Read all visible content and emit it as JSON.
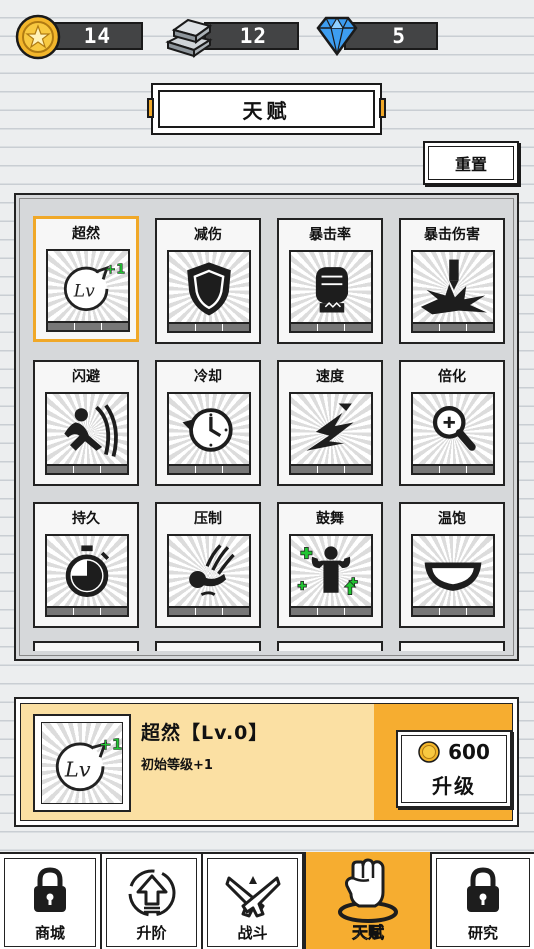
{
  "resources": {
    "coins": "14",
    "silver": "12",
    "diamonds": "5"
  },
  "title": "天赋",
  "reset_label": "重置",
  "talents": [
    {
      "name": "超然",
      "icon": "level-up-icon",
      "selected": true
    },
    {
      "name": "减伤",
      "icon": "shield-icon"
    },
    {
      "name": "暴击率",
      "icon": "fist-icon"
    },
    {
      "name": "暴击伤害",
      "icon": "critical-burst-icon"
    },
    {
      "name": "闪避",
      "icon": "dodge-icon"
    },
    {
      "name": "冷却",
      "icon": "cooldown-clock-icon"
    },
    {
      "name": "速度",
      "icon": "speed-icon"
    },
    {
      "name": "倍化",
      "icon": "magnify-icon"
    },
    {
      "name": "持久",
      "icon": "stopwatch-icon"
    },
    {
      "name": "压制",
      "icon": "suppress-icon"
    },
    {
      "name": "鼓舞",
      "icon": "inspire-icon"
    },
    {
      "name": "温饱",
      "icon": "bowl-icon"
    }
  ],
  "detail": {
    "name": "超然【Lv.0】",
    "description": "初始等级+1",
    "upgrade_cost": "600",
    "upgrade_label": "升级"
  },
  "nav": [
    {
      "label": "商城",
      "icon": "lock-icon"
    },
    {
      "label": "升阶",
      "icon": "upgrade-arrow-icon"
    },
    {
      "label": "战斗",
      "icon": "crossed-guns-icon"
    },
    {
      "label": "天赋",
      "icon": "fist-icon",
      "active": true
    },
    {
      "label": "研究",
      "icon": "lock-icon"
    }
  ],
  "colors": {
    "accent": "#f6ad30",
    "selected_border": "#f0a828",
    "detail_bg": "#fbe0a3",
    "resource_bar": "#434445",
    "plus_green": "#22c533"
  }
}
